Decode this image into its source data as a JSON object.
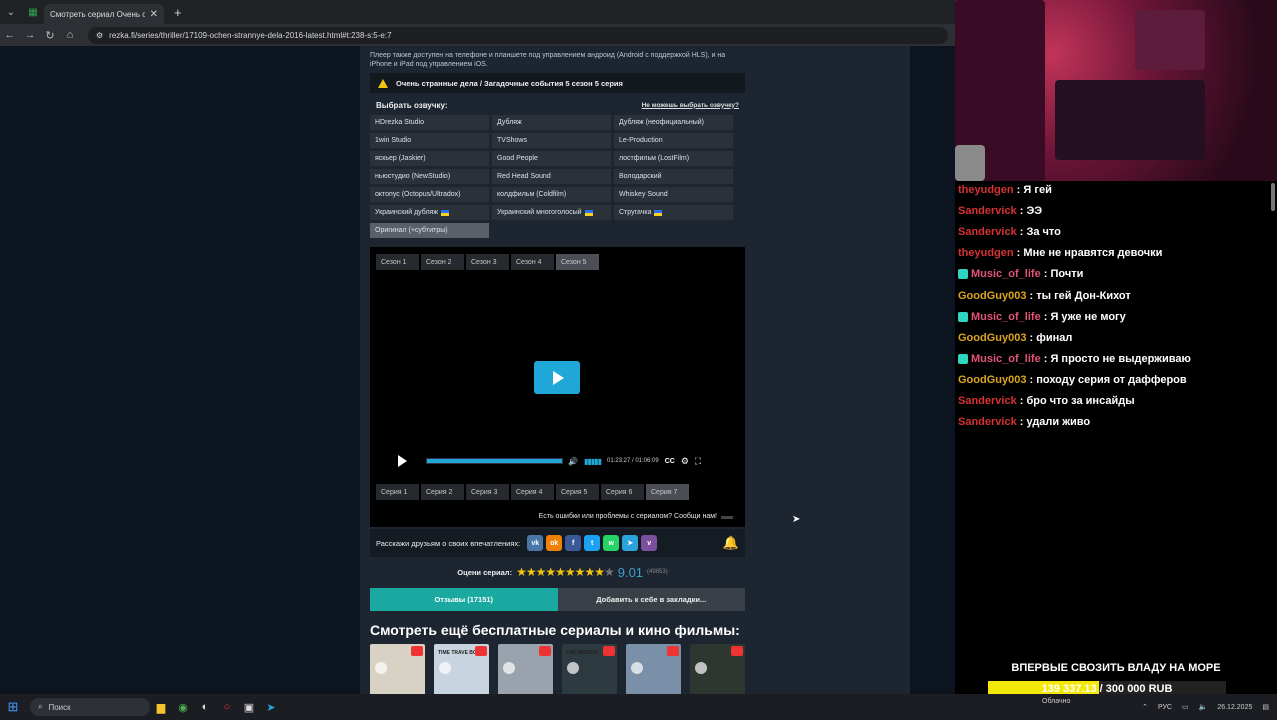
{
  "browser": {
    "tab_title": "Смотреть сериал Очень стран",
    "url": "rezka.fi/series/thriller/17109-ochen-strannye-dela-2016-latest.html#t:238-s:5-e:7"
  },
  "page": {
    "notice": "Плеер также доступен на телефоне и планшете под управлением андроид (Android с поддержкой HLS), и на iPhone и iPad под управлением iOS.",
    "episode_title": "Очень странные дела / Загадочные события 5 сезон 5 серия",
    "voice_label": "Выбрать озвучку:",
    "voice_help": "Не можешь выбрать озвучку?",
    "voices": [
      {
        "label": "HDrezka Studio",
        "flag": false
      },
      {
        "label": "Дубляж",
        "flag": false
      },
      {
        "label": "Дубляж (неофициальный)",
        "flag": false
      },
      {
        "label": "1win Studio",
        "flag": false
      },
      {
        "label": "TVShows",
        "flag": false
      },
      {
        "label": "Le-Production",
        "flag": false
      },
      {
        "label": "яскьер (Jaskier)",
        "flag": false
      },
      {
        "label": "Good People",
        "flag": false
      },
      {
        "label": "лостфильм (LostFilm)",
        "flag": false
      },
      {
        "label": "ньюстудио (NewStudio)",
        "flag": false
      },
      {
        "label": "Red Head Sound",
        "flag": false
      },
      {
        "label": "Володарский",
        "flag": false
      },
      {
        "label": "октопус (Octopus/Ultradox)",
        "flag": false
      },
      {
        "label": "колдфильм (Coldfilm)",
        "flag": false
      },
      {
        "label": "Whiskey Sound",
        "flag": false
      },
      {
        "label": "Украинский дубляж",
        "flag": true
      },
      {
        "label": "Украинский многоголосый",
        "flag": true
      },
      {
        "label": "Стругачка",
        "flag": true
      },
      {
        "label": "Оригинал (+субтитры)",
        "flag": false,
        "active": true
      }
    ],
    "seasons": [
      "Сезон 1",
      "Сезон 2",
      "Сезон 3",
      "Сезон 4",
      "Сезон 5"
    ],
    "active_season": 4,
    "player": {
      "time": "01:23:27 / 01:06:09",
      "cc": "CC",
      "progress_fraction": 1.0
    },
    "episodes": [
      "Серия 1",
      "Серия 2",
      "Серия 3",
      "Серия 4",
      "Серия 5",
      "Серия 6",
      "Серия 7"
    ],
    "active_episode": 6,
    "report": "Есть ошибки или проблемы с сериалом? Сообщи нам!",
    "share_text": "Расскажи друзьям о своих впечатлениях:",
    "social": [
      {
        "name": "vk-icon",
        "glyph": "vk",
        "color": "#4a76a8"
      },
      {
        "name": "ok-icon",
        "glyph": "ok",
        "color": "#ee8208"
      },
      {
        "name": "facebook-icon",
        "glyph": "f",
        "color": "#3b5998"
      },
      {
        "name": "twitter-icon",
        "glyph": "t",
        "color": "#1da1f2"
      },
      {
        "name": "whatsapp-icon",
        "glyph": "w",
        "color": "#25d366"
      },
      {
        "name": "telegram-icon",
        "glyph": "➤",
        "color": "#2aa3dc"
      },
      {
        "name": "viber-icon",
        "glyph": "v",
        "color": "#7b519d"
      }
    ],
    "rating_label": "Оцени сериал:",
    "rating_stars": 9,
    "rating_max": 10,
    "score": "9.01",
    "votes": "(49853)",
    "tab_reviews": "Отзывы (17151)",
    "tab_bookmark": "Добавить к себе в закладки...",
    "more_title": "Смотреть ещё бесплатные сериалы и кино фильмы:",
    "thumbnails": [
      {
        "label": "",
        "color": "#d8d2c4"
      },
      {
        "label": "TIME TRAVE BONG",
        "color": "#c8d4e0"
      },
      {
        "label": "",
        "color": "#9aa3ad"
      },
      {
        "label": "THE MISSING",
        "color": "#2d3a40"
      },
      {
        "label": "",
        "color": "#7a8fa8"
      },
      {
        "label": "",
        "color": "#2e3630"
      }
    ]
  },
  "chat": {
    "messages": [
      {
        "user": "theyudgen",
        "color": "#d63232",
        "text": "Я гей",
        "badge": false
      },
      {
        "user": "Sandervick",
        "color": "#d63232",
        "text": "ЭЭ",
        "badge": false
      },
      {
        "user": "Sandervick",
        "color": "#d63232",
        "text": "За что",
        "badge": false
      },
      {
        "user": "theyudgen",
        "color": "#d63232",
        "text": "Мне не нравятся девочки",
        "badge": false
      },
      {
        "user": "Music_of_life",
        "color": "#e05577",
        "text": "Почти",
        "badge": true
      },
      {
        "user": "GoodGuy003",
        "color": "#daa520",
        "text": "ты гей Дон-Кихот",
        "badge": false
      },
      {
        "user": "Music_of_life",
        "color": "#e05577",
        "text": "Я уже не могу",
        "badge": true
      },
      {
        "user": "GoodGuy003",
        "color": "#daa520",
        "text": "финал",
        "badge": false
      },
      {
        "user": "Music_of_life",
        "color": "#e05577",
        "text": "Я просто не выдерживаю",
        "badge": true
      },
      {
        "user": "GoodGuy003",
        "color": "#daa520",
        "text": "походу серия от дафферов",
        "badge": false
      },
      {
        "user": "Sandervick",
        "color": "#d63232",
        "text": "бро что за инсайды",
        "badge": false
      },
      {
        "user": "Sandervick",
        "color": "#d63232",
        "text": "удали живо",
        "badge": false
      }
    ]
  },
  "donation": {
    "title": "ВПЕРВЫЕ СВОЗИТЬ ВЛАДУ НА МОРЕ",
    "progress_text": "139 337.13 / 300 000 RUB",
    "fraction": 0.4645
  },
  "taskbar": {
    "search": "Поиск",
    "weather": "Облачно",
    "lang": "РУС",
    "date": "26.12.2025"
  }
}
